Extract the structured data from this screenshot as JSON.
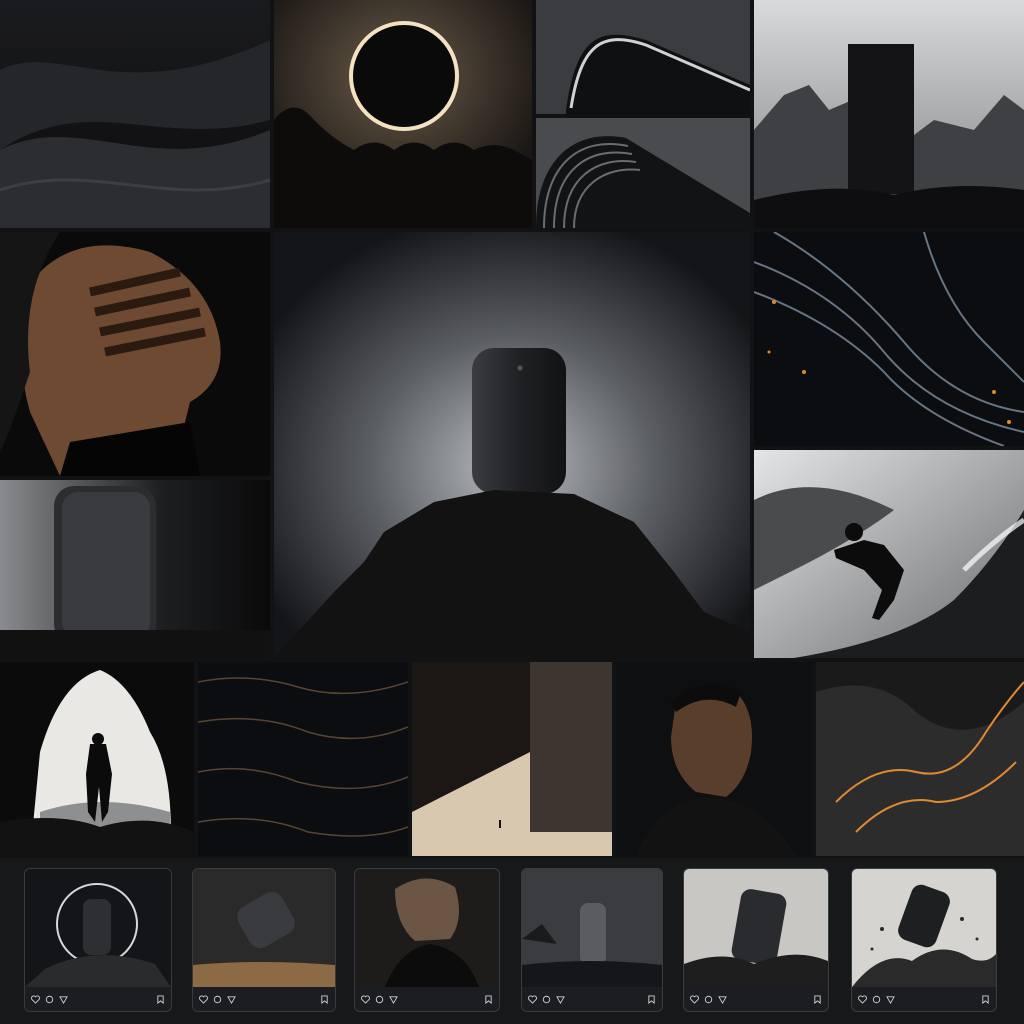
{
  "collage": {
    "tiles": [
      {
        "name": "black-sand-dunes-photo"
      },
      {
        "name": "solar-eclipse-crowd-photo"
      },
      {
        "name": "curved-product-edge-photo"
      },
      {
        "name": "ribbed-product-surface-photo"
      },
      {
        "name": "monolith-mountains-photo"
      },
      {
        "name": "woman-face-shadow-photo"
      },
      {
        "name": "speaker-on-rock-hero-photo"
      },
      {
        "name": "liquid-waves-sparks-photo"
      },
      {
        "name": "speaker-side-view-photo"
      },
      {
        "name": "surfer-wave-photo"
      },
      {
        "name": "cave-silhouette-photo"
      },
      {
        "name": "dark-water-surface-photo"
      },
      {
        "name": "architecture-tiny-figure-photo"
      },
      {
        "name": "man-portrait-photo"
      },
      {
        "name": "smoke-sparks-photo"
      }
    ]
  },
  "social_feed": {
    "posts": [
      {
        "name": "speaker-halo-post"
      },
      {
        "name": "floating-speaker-sand-post"
      },
      {
        "name": "portrait-hand-post"
      },
      {
        "name": "speaker-sea-rocks-post"
      },
      {
        "name": "speaker-on-boulders-post"
      },
      {
        "name": "speaker-dust-explosion-post"
      }
    ],
    "icons": [
      "heart-icon",
      "comment-icon",
      "share-icon",
      "bookmark-icon"
    ]
  }
}
